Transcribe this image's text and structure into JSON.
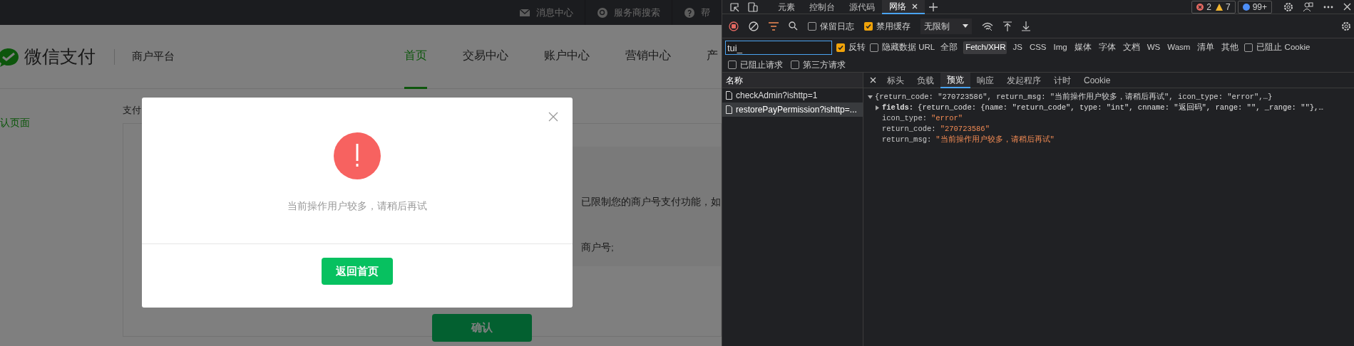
{
  "page": {
    "top_links": [
      {
        "label": "消息中心",
        "kind": "mail"
      },
      {
        "label": "服务商搜索",
        "kind": "search"
      },
      {
        "label": "帮",
        "kind": "help"
      }
    ],
    "brand": "微信支付",
    "platform": "商户平台",
    "nav": [
      {
        "label": "首页",
        "selected": true
      },
      {
        "label": "交易中心",
        "selected": false
      },
      {
        "label": "账户中心",
        "selected": false
      },
      {
        "label": "营销中心",
        "selected": false
      },
      {
        "label": "产",
        "selected": false
      }
    ],
    "sidebar_item": "认页面",
    "section_title": "支付",
    "notice_lines": [
      "已限制您的商户号支付功能，如",
      "商户号;"
    ],
    "confirm_button": "确认"
  },
  "dialog": {
    "message": "当前操作用户较多，请稍后再试",
    "button": "返回首页"
  },
  "devtools": {
    "tabs": [
      {
        "label": "元素",
        "selected": false
      },
      {
        "label": "控制台",
        "selected": false
      },
      {
        "label": "源代码",
        "selected": false
      },
      {
        "label": "网络",
        "selected": true
      }
    ],
    "errors": "2",
    "warnings": "7",
    "issues": "99+",
    "toolbar_options": [
      {
        "label": "保留日志",
        "checked": false
      },
      {
        "label": "禁用缓存",
        "checked": true
      }
    ],
    "throttle": "无限制",
    "filter": {
      "value": "tui_"
    },
    "filter_options": [
      {
        "label": "反转",
        "checked": true
      },
      {
        "label": "隐藏数据 URL",
        "checked": false
      }
    ],
    "type_filters": [
      {
        "label": "全部",
        "selected": false
      },
      {
        "label": "Fetch/XHR",
        "selected": true
      },
      {
        "label": "JS",
        "selected": false
      },
      {
        "label": "CSS",
        "selected": false
      },
      {
        "label": "Img",
        "selected": false
      },
      {
        "label": "媒体",
        "selected": false
      },
      {
        "label": "字体",
        "selected": false
      },
      {
        "label": "文档",
        "selected": false
      },
      {
        "label": "WS",
        "selected": false
      },
      {
        "label": "Wasm",
        "selected": false
      },
      {
        "label": "清单",
        "selected": false
      },
      {
        "label": "其他",
        "selected": false
      }
    ],
    "blocked_cookies": {
      "label": "已阻止 Cookie",
      "checked": false
    },
    "extra_options": [
      {
        "label": "已阻止请求",
        "checked": false
      },
      {
        "label": "第三方请求",
        "checked": false
      }
    ],
    "requests": {
      "header": "名称",
      "items": [
        {
          "name": "checkAdmin?ishttp=1",
          "selected": false
        },
        {
          "name": "restorePayPermission?ishttp=...",
          "selected": true
        }
      ]
    },
    "detail_tabs": [
      {
        "label": "标头",
        "selected": false
      },
      {
        "label": "负载",
        "selected": false
      },
      {
        "label": "预览",
        "selected": true
      },
      {
        "label": "响应",
        "selected": false
      },
      {
        "label": "发起程序",
        "selected": false
      },
      {
        "label": "计时",
        "selected": false
      },
      {
        "label": "Cookie",
        "selected": false
      }
    ],
    "preview": [
      {
        "kind": "summary",
        "expanded": true,
        "text": "{return_code: \"270723586\", return_msg: \"当前操作用户较多，请稍后再试\", icon_type: \"error\",…}"
      },
      {
        "kind": "object",
        "expanded": false,
        "key": "fields:",
        "text": "{return_code: {name: \"return_code\", type: \"int\", cnname: \"返回码\", range: \"\", _range: \"\"},…"
      },
      {
        "kind": "string",
        "key": "icon_type:",
        "text": "\"error\""
      },
      {
        "kind": "string",
        "key": "return_code:",
        "text": "\"270723586\""
      },
      {
        "kind": "string",
        "key": "return_msg:",
        "text": "\"当前操作用户较多，请稍后再试\""
      }
    ]
  }
}
